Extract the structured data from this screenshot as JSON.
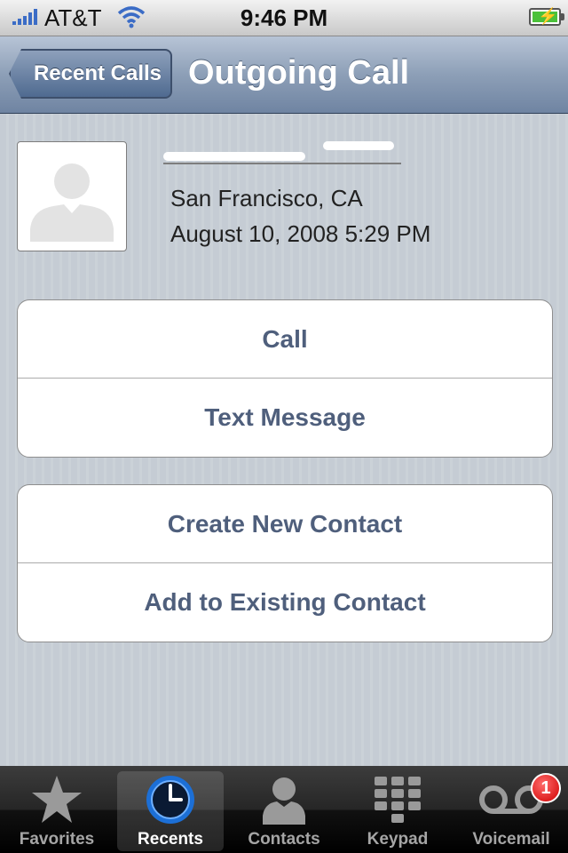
{
  "status_bar": {
    "carrier": "AT&T",
    "time": "9:46 PM",
    "signal_bars": 5,
    "battery": "charging"
  },
  "nav": {
    "back_label": "Recent Calls",
    "title": "Outgoing Call"
  },
  "call_info": {
    "location": "San Francisco, CA",
    "datetime": "August 10, 2008 5:29 PM"
  },
  "actions": {
    "group1": [
      {
        "label": "Call"
      },
      {
        "label": "Text Message"
      }
    ],
    "group2": [
      {
        "label": "Create New Contact"
      },
      {
        "label": "Add to Existing Contact"
      }
    ]
  },
  "tabs": [
    {
      "label": "Favorites",
      "icon": "star-icon"
    },
    {
      "label": "Recents",
      "icon": "clock-icon",
      "active": true
    },
    {
      "label": "Contacts",
      "icon": "person-icon"
    },
    {
      "label": "Keypad",
      "icon": "keypad-icon"
    },
    {
      "label": "Voicemail",
      "icon": "voicemail-icon",
      "badge": "1"
    }
  ],
  "colors": {
    "nav_accent": "#6f84a2",
    "button_text": "#4f5f7c",
    "badge": "#d00000"
  }
}
